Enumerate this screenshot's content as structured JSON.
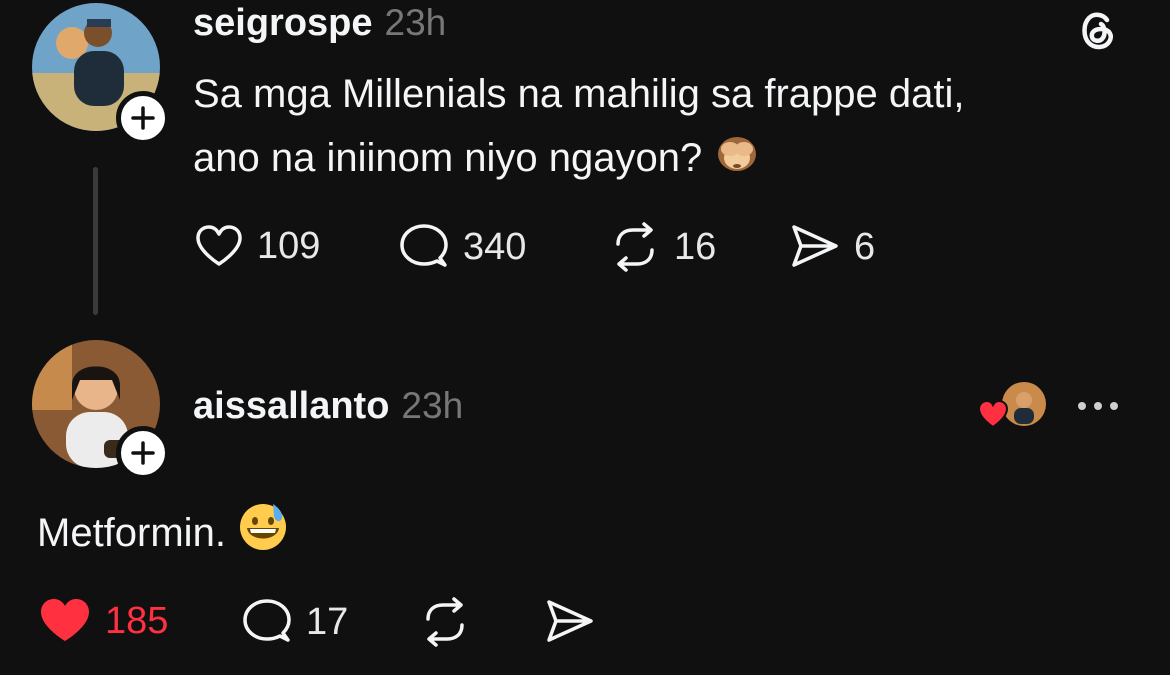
{
  "post": {
    "username": "seigrospe",
    "time": "23h",
    "text_line1": "Sa mga Millenials na mahilig sa frappe dati,",
    "text_line2": "ano na iniinom niyo ngayon?",
    "emoji_icon": "see-no-evil-monkey",
    "likes": "109",
    "replies": "340",
    "reposts": "16",
    "shares": "6"
  },
  "reply": {
    "username": "aissallanto",
    "time": "23h",
    "text": "Metformin.",
    "emoji_icon": "grinning-sweat-face",
    "likes": "185",
    "replies": "17",
    "liked_by_author_icon": "heart-with-avatar"
  },
  "colors": {
    "background": "#101010",
    "text": "#f3f5f7",
    "muted": "#777777",
    "like_red": "#ff3040"
  }
}
